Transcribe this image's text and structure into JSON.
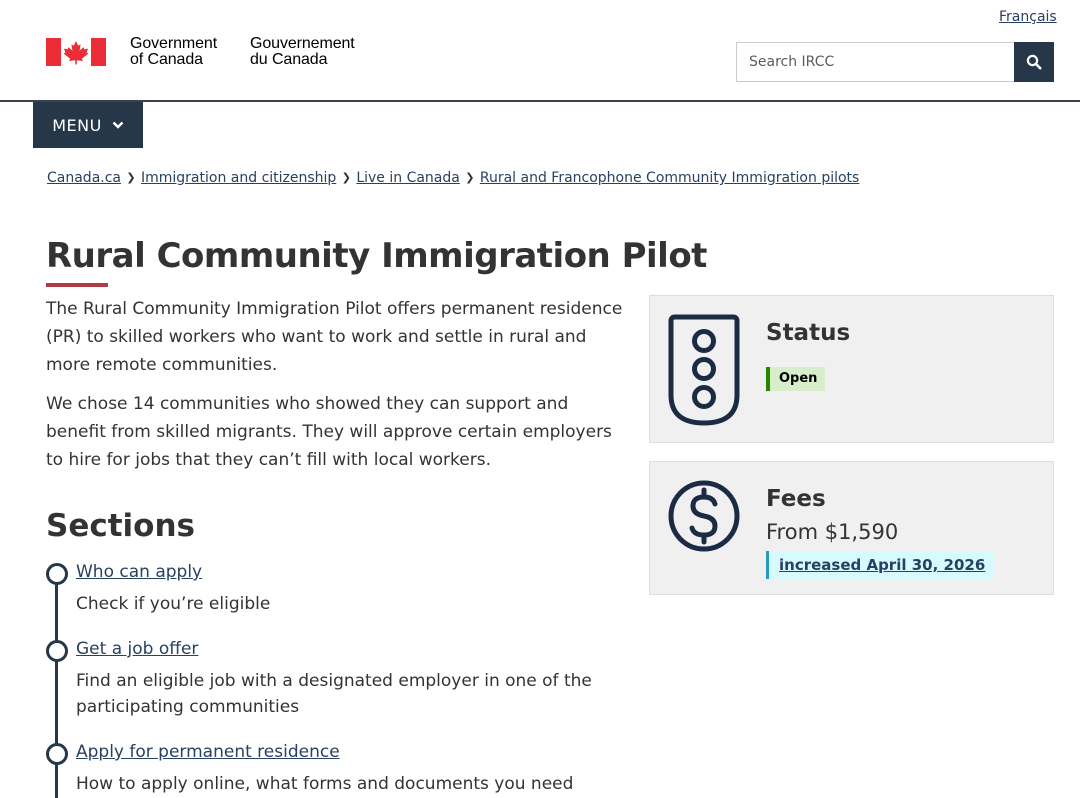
{
  "header": {
    "language_link": "Français",
    "signature_en_line1": "Government",
    "signature_en_line2": "of Canada",
    "signature_fr_line1": "Gouvernement",
    "signature_fr_line2": "du Canada",
    "search_placeholder": "Search IRCC",
    "search_icon": "search-icon",
    "menu_label": "MENU",
    "menu_icon": "chevron-down-icon"
  },
  "breadcrumb": [
    "Canada.ca",
    "Immigration and citizenship",
    "Live in Canada",
    "Rural and Francophone Community Immigration pilots"
  ],
  "main": {
    "title": "Rural Community Immigration Pilot",
    "intro_1": "The Rural Community Immigration Pilot offers permanent residence (PR) to skilled workers who want to work and settle in rural and more remote communities.",
    "intro_2": "We chose 14 communities who showed they can support and benefit from skilled migrants. They will approve certain employers to hire for jobs that they can’t fill with local workers.",
    "sections_heading": "Sections",
    "steps": [
      {
        "link": "Who can apply",
        "desc": "Check if you’re eligible"
      },
      {
        "link": "Get a job offer",
        "desc": "Find an eligible job with a designated employer in one of the participating communities"
      },
      {
        "link": "Apply for permanent residence",
        "desc": "How to apply online, what forms and documents you need"
      }
    ]
  },
  "status_panel": {
    "icon": "traffic-light-icon",
    "title": "Status",
    "badge": "Open"
  },
  "fees_panel": {
    "icon": "dollar-icon",
    "title": "Fees",
    "amount": "From $1,590",
    "note": "increased April 30, 2026"
  },
  "colors": {
    "brand_dark": "#26374a",
    "link": "#284162",
    "title_accent": "#af3c43",
    "flag_red": "#eb2d37",
    "open_badge_bg": "#d8eeca",
    "open_badge_border": "#278400",
    "info_badge_bg": "#d7faff",
    "info_badge_border": "#269abc"
  }
}
